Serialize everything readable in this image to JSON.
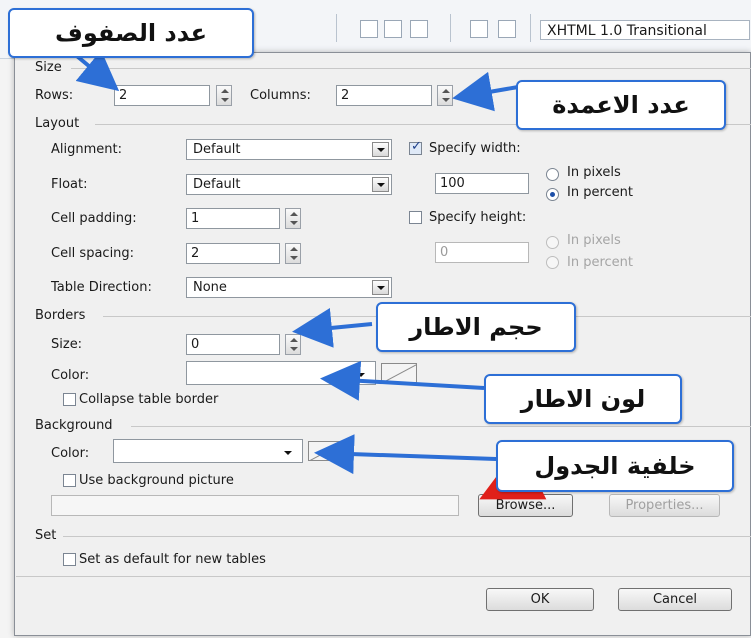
{
  "toolbar": {
    "doctype": "XHTML 1.0 Transitional"
  },
  "sections": {
    "size": "Size",
    "layout": "Layout",
    "borders": "Borders",
    "background": "Background",
    "set": "Set"
  },
  "size": {
    "rows_label": "Rows:",
    "rows_value": "2",
    "columns_label": "Columns:",
    "columns_value": "2"
  },
  "layout": {
    "alignment_label": "Alignment:",
    "alignment_value": "Default",
    "float_label": "Float:",
    "float_value": "Default",
    "cell_padding_label": "Cell padding:",
    "cell_padding_value": "1",
    "cell_spacing_label": "Cell spacing:",
    "cell_spacing_value": "2",
    "table_direction_label": "Table Direction:",
    "table_direction_value": "None",
    "specify_width_label": "Specify width:",
    "width_value": "100",
    "in_pixels": "In pixels",
    "in_percent": "In percent",
    "specify_height_label": "Specify height:",
    "height_value": "0"
  },
  "borders": {
    "size_label": "Size:",
    "size_value": "0",
    "color_label": "Color:",
    "collapse_label": "Collapse table border"
  },
  "background": {
    "color_label": "Color:",
    "use_picture_label": "Use background picture",
    "browse_label": "Browse...",
    "properties_label": "Properties..."
  },
  "set": {
    "default_label": "Set as default for new tables"
  },
  "buttons": {
    "ok": "OK",
    "cancel": "Cancel"
  },
  "callouts": {
    "rows": "عدد الصفوف",
    "columns": "عدد الاعمدة",
    "border_size": "حجم الاطار",
    "border_color": "لون الاطار",
    "table_background": "خلفية الجدول"
  },
  "colors": {
    "callout_border": "#2d6fd6",
    "arrow": "#2d6fd6",
    "red_arrow": "#e0201a"
  }
}
